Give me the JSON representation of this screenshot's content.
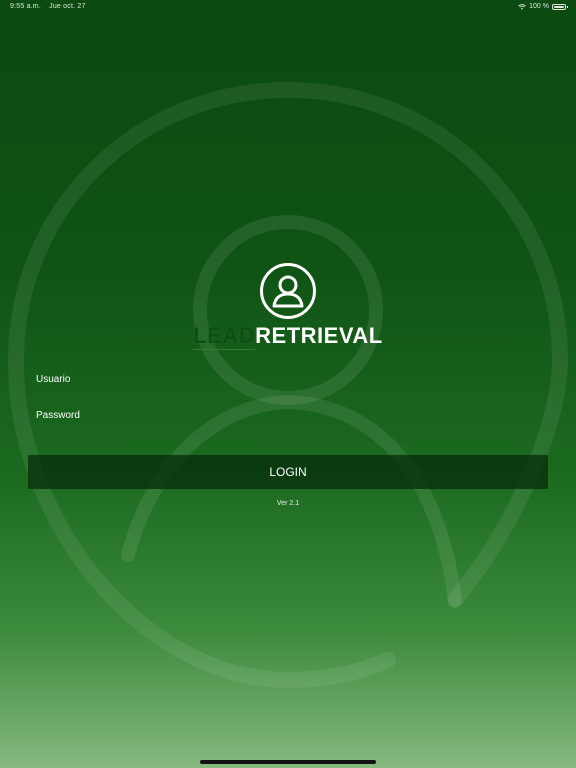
{
  "status_bar": {
    "time": "9:55 a.m.",
    "date": "Jue oct. 27",
    "battery": "100 %"
  },
  "logo": {
    "word_lead": "LEAD",
    "word_retrieval": "RETRIEVAL",
    "icon": "user-circle-icon"
  },
  "form": {
    "username_placeholder": "Usuario",
    "password_placeholder": "Password",
    "login_label": "LOGIN"
  },
  "version": "Ver 2.1",
  "colors": {
    "background_top": "#0b4a10",
    "background_bottom": "#86b97f",
    "button_bg": "#062c0a",
    "text": "#ffffff"
  }
}
